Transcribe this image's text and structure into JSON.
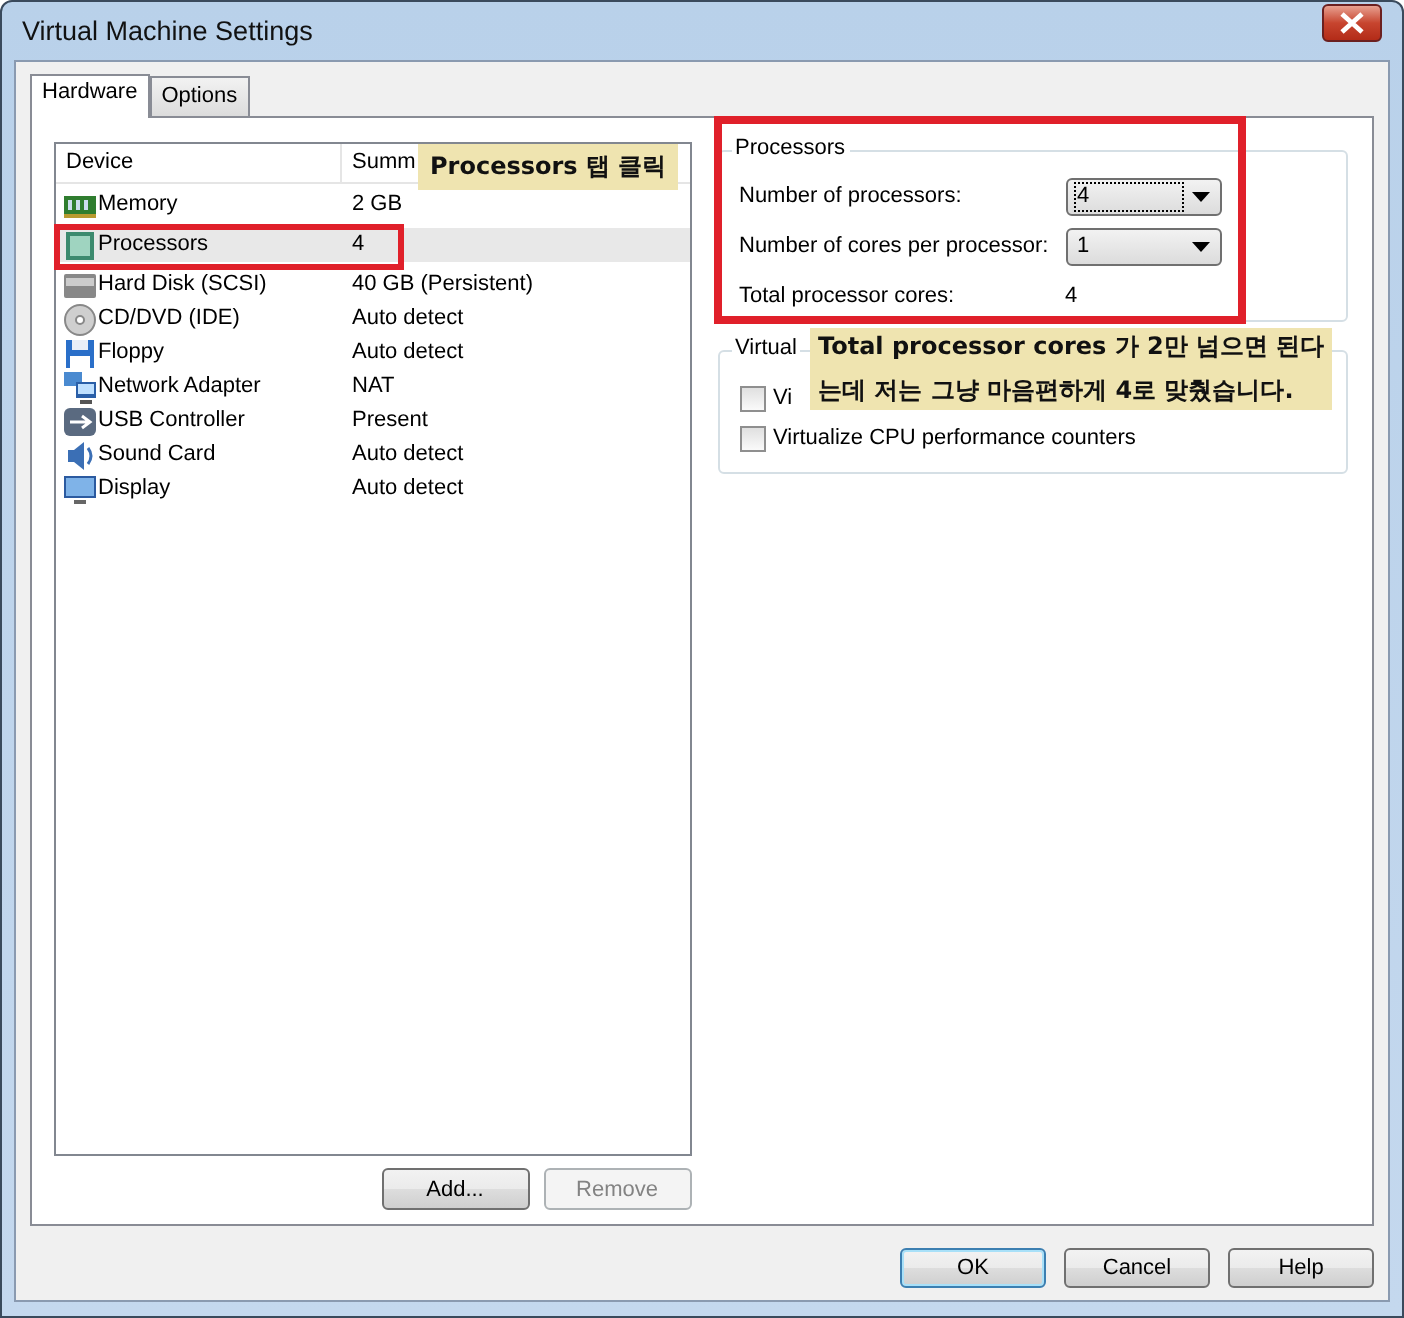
{
  "window": {
    "title": "Virtual Machine Settings"
  },
  "tabs": [
    {
      "label": "Hardware",
      "selected": true
    },
    {
      "label": "Options",
      "selected": false
    }
  ],
  "device_list": {
    "columns": [
      "Device",
      "Summ"
    ],
    "rows": [
      {
        "kind": "memory",
        "device": "Memory",
        "summary": "2 GB",
        "selected": false
      },
      {
        "kind": "processor",
        "device": "Processors",
        "summary": "4",
        "selected": true
      },
      {
        "kind": "disk",
        "device": "Hard Disk (SCSI)",
        "summary": "40 GB (Persistent)",
        "selected": false
      },
      {
        "kind": "cd",
        "device": "CD/DVD (IDE)",
        "summary": "Auto detect",
        "selected": false
      },
      {
        "kind": "floppy",
        "device": "Floppy",
        "summary": "Auto detect",
        "selected": false
      },
      {
        "kind": "network",
        "device": "Network Adapter",
        "summary": "NAT",
        "selected": false
      },
      {
        "kind": "usb",
        "device": "USB Controller",
        "summary": "Present",
        "selected": false
      },
      {
        "kind": "sound",
        "device": "Sound Card",
        "summary": "Auto detect",
        "selected": false
      },
      {
        "kind": "display",
        "device": "Display",
        "summary": "Auto detect",
        "selected": false
      }
    ],
    "buttons": [
      {
        "label": "Add...",
        "disabled": false
      },
      {
        "label": "Remove",
        "disabled": true
      }
    ]
  },
  "processors": {
    "title": "Processors",
    "fields": [
      {
        "label": "Number of processors:",
        "value": "4",
        "focused": true
      },
      {
        "label": "Number of cores per processor:",
        "value": "1",
        "focused": false
      }
    ],
    "total_label": "Total processor cores:",
    "total_value": "4"
  },
  "virtualization": {
    "title": "Virtual",
    "options": [
      {
        "label": "Vi",
        "checked": false
      },
      {
        "label": "Virtualize CPU performance counters",
        "checked": false
      }
    ]
  },
  "footer_buttons": [
    {
      "label": "OK",
      "default": true
    },
    {
      "label": "Cancel",
      "default": false
    },
    {
      "label": "Help",
      "default": false
    }
  ],
  "annotations": [
    {
      "lines": [
        "Processors 탭 클릭"
      ]
    },
    {
      "lines": [
        "Total processor cores 가 2만 넘으면 된다",
        "는데 저는 그냥 마음편하게 4로 맞췄습니다."
      ]
    }
  ]
}
